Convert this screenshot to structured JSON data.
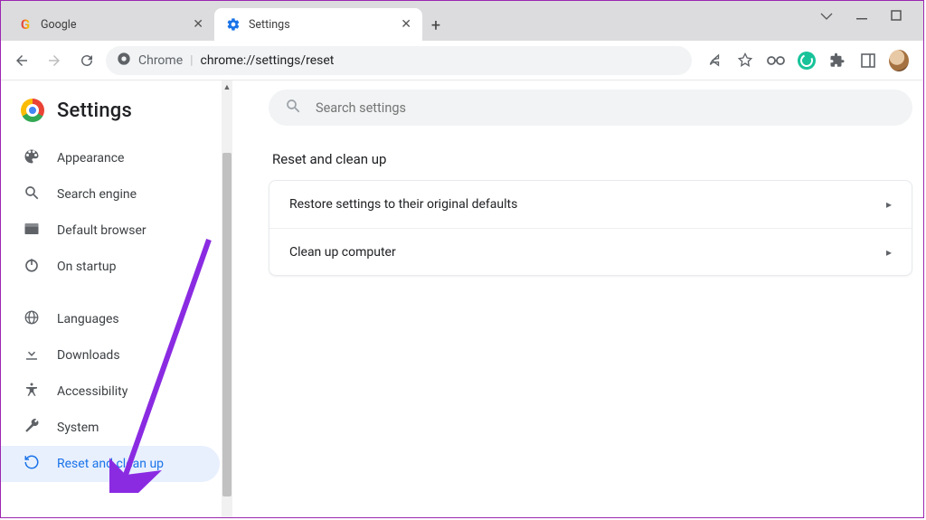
{
  "window": {
    "tabs": [
      {
        "title": "Google",
        "favicon": "google"
      },
      {
        "title": "Settings",
        "favicon": "gear"
      }
    ],
    "active_tab_index": 1
  },
  "toolbar": {
    "url_host": "Chrome",
    "url_path": "chrome://settings/reset"
  },
  "settings": {
    "title": "Settings",
    "search_placeholder": "Search settings",
    "nav_group1": [
      {
        "icon": "palette",
        "label": "Appearance"
      },
      {
        "icon": "search",
        "label": "Search engine"
      },
      {
        "icon": "browser",
        "label": "Default browser"
      },
      {
        "icon": "power",
        "label": "On startup"
      }
    ],
    "nav_group2": [
      {
        "icon": "globe",
        "label": "Languages"
      },
      {
        "icon": "download",
        "label": "Downloads"
      },
      {
        "icon": "a11y",
        "label": "Accessibility"
      },
      {
        "icon": "wrench",
        "label": "System"
      },
      {
        "icon": "reset",
        "label": "Reset and clean up",
        "active": true
      }
    ],
    "section_title": "Reset and clean up",
    "rows": [
      "Restore settings to their original defaults",
      "Clean up computer"
    ]
  }
}
